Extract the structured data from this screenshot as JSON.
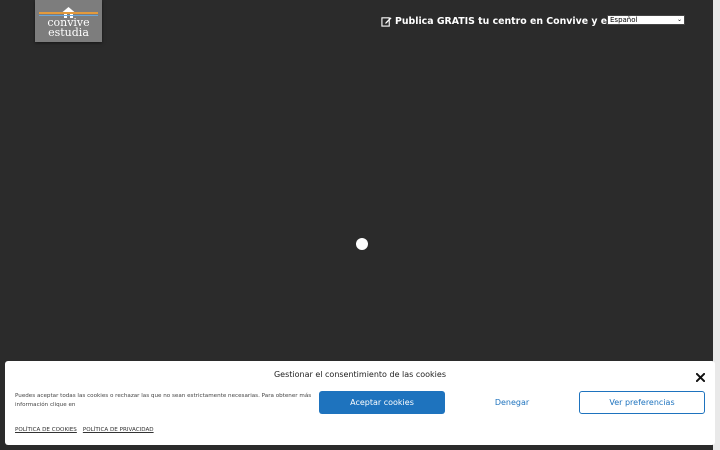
{
  "logo": {
    "line1": "convive",
    "line2": "estudia",
    "icon": "house-icon"
  },
  "header": {
    "publish_label": "Publica GRATIS tu centro en Convive y estudia",
    "publish_icon": "edit-icon",
    "language_selected": "Español"
  },
  "cookie_banner": {
    "title": "Gestionar el consentimiento de las cookies",
    "text": "Puedes aceptar todas las cookies o rechazar las que no sean estrictamente necesarias. Para obtener más información clique en",
    "accept_label": "Aceptar cookies",
    "deny_label": "Denegar",
    "preferences_label": "Ver preferencias",
    "links": [
      "POLÍTICA DE COOKIES",
      "POLÍTICA DE PRIVACIDAD"
    ]
  },
  "colors": {
    "background": "#2b2b2b",
    "accent": "#1e73be"
  }
}
